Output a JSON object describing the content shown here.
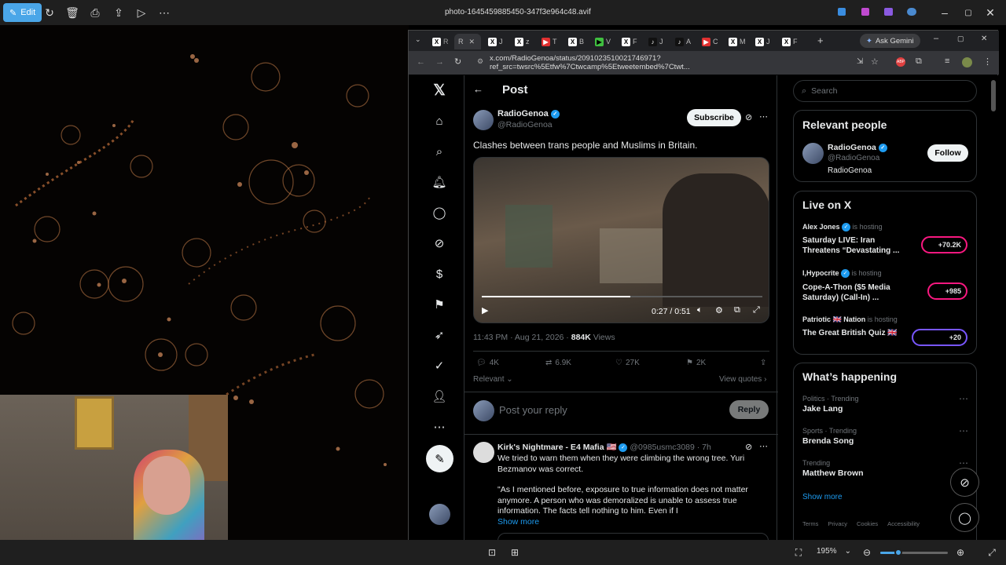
{
  "viewer": {
    "edit_label": "Edit",
    "filename": "photo-1645459885450-347f3e964c48.avif",
    "zoom": "195%"
  },
  "browser": {
    "gemini_label": "Ask Gemini",
    "url": "x.com/RadioGenoa/status/2091023510021746971?ref_src=twsrc%5Etfw%7Ctwcamp%5Etweetembed%7Ctwt...",
    "tabs": [
      "R",
      "J",
      "z",
      "T",
      "B",
      "V",
      "F",
      "J",
      "A",
      "C",
      "M",
      "J",
      "F"
    ]
  },
  "x": {
    "header_title": "Post",
    "post": {
      "author_name": "RadioGenoa",
      "author_handle": "@RadioGenoa",
      "subscribe_label": "Subscribe",
      "text": "Clashes between trans people and Muslims in Britain.",
      "video_time": "0:27 / 0:51",
      "progress": 0.53,
      "timestamp": "11:43 PM · Aug 21, 2026 ·",
      "views_count": "884K",
      "views_label": "Views",
      "replies": "4K",
      "reposts": "6.9K",
      "likes": "27K",
      "bookmarks": "2K",
      "sort_label": "Relevant",
      "view_quotes": "View quotes"
    },
    "reply_box": {
      "placeholder": "Post your reply",
      "button": "Reply"
    },
    "reply": {
      "name": "Kirk's Nightmare - E4 Mafia",
      "flag": "🇺🇸",
      "handle_time": "@0985usmc3089 · 7h",
      "line1": "We tried to warn them when they were climbing the wrong tree. Yuri",
      "line2": "Bezmanov was correct.",
      "line3": "\"As I mentioned before, exposure to true information does not matter",
      "line4": "anymore. A person who was demoralized is unable to assess true",
      "line5": "information. The facts tell nothing to him. Even if I",
      "show_more": "Show more"
    },
    "search_placeholder": "Search",
    "relevant": {
      "title": "Relevant people",
      "name": "RadioGenoa",
      "handle": "@RadioGenoa",
      "bio": "RadioGenoa",
      "follow": "Follow"
    },
    "live": {
      "title": "Live on X",
      "items": [
        {
          "host": "Alex Jones",
          "hosting": "is hosting",
          "title1": "Saturday LIVE: Iran",
          "title2": "Threatens “Devastating ...",
          "count": "+70.2K"
        },
        {
          "host": "I,Hypocrite",
          "hosting": "is hosting",
          "title1": "Cope-A-Thon ($5 Media",
          "title2": "Saturday) (Call-In) ...",
          "count": "+985"
        },
        {
          "host": "Patriotic 🇬🇧 Nation",
          "hosting": "is hosting",
          "title1": "The Great British Quiz 🇬🇧",
          "title2": "",
          "count": "+20"
        }
      ]
    },
    "happening": {
      "title": "What’s happening",
      "items": [
        {
          "meta": "Politics · Trending",
          "name": "Jake Lang"
        },
        {
          "meta": "Sports · Trending",
          "name": "Brenda Song"
        },
        {
          "meta": "Trending",
          "name": "Matthew Brown"
        }
      ],
      "show_more": "Show more",
      "footer": [
        "Terms",
        "Privacy",
        "Cookies",
        "Accessibility"
      ]
    }
  }
}
